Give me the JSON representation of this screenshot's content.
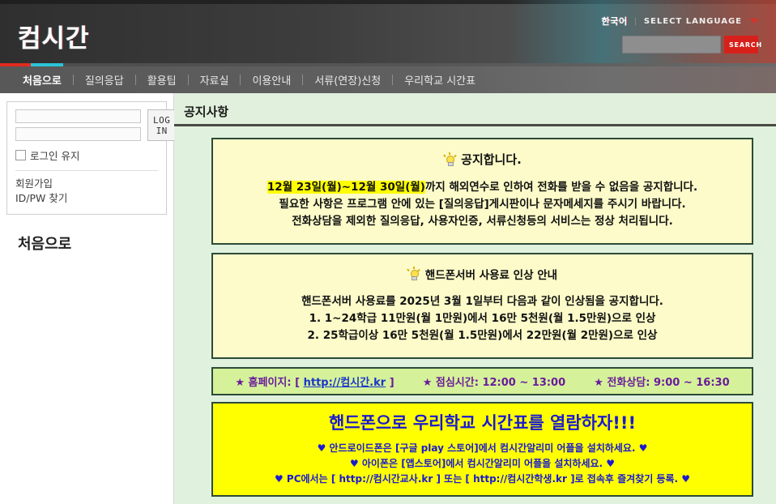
{
  "header": {
    "logo": "컴시간",
    "language_current": "한국어",
    "language_separator": "|",
    "language_select": "SELECT LANGUAGE",
    "search_placeholder": "",
    "search_value": "",
    "search_button": "SEARCH"
  },
  "nav": {
    "items": [
      {
        "label": "처음으로",
        "active": true
      },
      {
        "label": "질의응답",
        "active": false
      },
      {
        "label": "활용팁",
        "active": false
      },
      {
        "label": "자료실",
        "active": false
      },
      {
        "label": "이용안내",
        "active": false
      },
      {
        "label": "서류(연장)신청",
        "active": false
      },
      {
        "label": "우리학교 시간표",
        "active": false
      }
    ]
  },
  "sidebar": {
    "id_value": "",
    "id_placeholder": "",
    "pw_value": "",
    "pw_placeholder": "",
    "login_button": "LOG IN",
    "keep_login_label": "로그인 유지",
    "links": [
      "회원가입",
      "ID/PW 찾기"
    ],
    "section_title": "처음으로"
  },
  "content": {
    "page_title": "공지사항",
    "notice1": {
      "title": "공지합니다.",
      "highlight": "12월 23일(월)~12월 30일(월)",
      "line1_rest": "까지 해외연수로 인하여 전화를 받을 수 없음을 공지합니다.",
      "line2": "필요한 사항은 프로그램 안에 있는 [질의응답]게시판이나 문자메세지를 주시기 바랍니다.",
      "line3": "전화상담을 제외한 질의응답, 사용자인증, 서류신청등의 서비스는 정상 처리됩니다."
    },
    "notice2": {
      "title": "핸드폰서버 사용료 인상 안내",
      "line1": "핸드폰서버 사용료를 2025년 3월 1일부터 다음과 같이 인상됨을 공지합니다.",
      "line2": "1. 1~24학급 11만원(월 1만원)에서 16만 5천원(월 1.5만원)으로 인상",
      "line3": "2. 25학급이상 16만 5천원(월 1.5만원)에서 22만원(월 2만원)으로 인상"
    },
    "info_bar": {
      "homepage_label": "★ 홈페이지: [",
      "homepage_url": "http://컴시간.kr",
      "homepage_close": "]",
      "lunch": "★ 점심시간: 12:00 ~ 13:00",
      "phone": "★ 전화상담: 9:00 ~ 16:30"
    },
    "promo": {
      "title": "핸드폰으로 우리학교 시간표를 열람하자!!!",
      "line1": "♥ 안드로이드폰은 [구글 play 스토어]에서 컴시간알리미 어플을 설치하세요. ♥",
      "line2": "♥ 아이폰은 [앱스토어]에서 컴시간알리미 어플을 설치하세요. ♥",
      "line3": "♥ PC에서는 [ http://컴시간교사.kr ] 또는 [ http://컴시간학생.kr ]로 접속후 즐겨찾기 등록. ♥"
    }
  },
  "colors": {
    "accent_red": "#d8201b",
    "accent_cyan": "#2bc4d8",
    "content_green": "#e0f2de",
    "notice_yellow": "#fcfbc9",
    "promo_yellow": "#ffff00",
    "promo_blue": "#1a1ad0",
    "info_purple": "#6a1b9a"
  }
}
